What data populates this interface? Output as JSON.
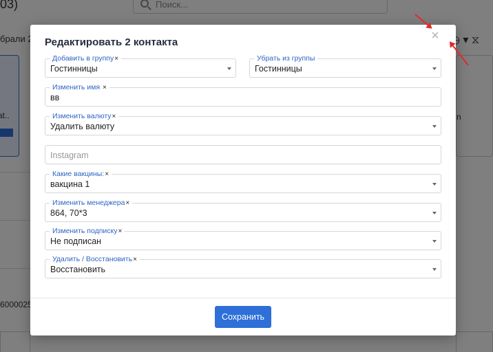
{
  "background": {
    "header_fragment": "03)",
    "search_placeholder": "Поиск...",
    "selected_fragment": "брали 2",
    "card_fragment": "at..",
    "number_fragment": "6000025",
    "right_fragment": "n"
  },
  "modal": {
    "title": "Редактировать 2 контакта",
    "fields": {
      "add_group": {
        "label": "Добавить в группу",
        "value": "Гостинницы"
      },
      "remove_group": {
        "label": "Убрать из группы",
        "value": "Гостинницы"
      },
      "change_name": {
        "label": "Изменить имя",
        "value": "вв"
      },
      "change_currency": {
        "label": "Изменить валюту",
        "value": "Удалить валюту"
      },
      "instagram": {
        "placeholder": "Instagram"
      },
      "vaccines": {
        "label": "Какие вакцины:",
        "value": "вакцина 1"
      },
      "manager": {
        "label": "Изменить менеджера",
        "value": "864, 70*3"
      },
      "subscription": {
        "label": "Изменить подписку",
        "value": "Не подписан"
      },
      "delete_restore": {
        "label": "Удалить / Восстановить",
        "value": "Восстановить"
      }
    },
    "remove_glyph": "×",
    "close_glyph": "×",
    "save_label": "Сохранить"
  },
  "colors": {
    "accent": "#2e6fd8",
    "label_blue": "#2d64c4",
    "annotation_red": "#e12a2a"
  }
}
